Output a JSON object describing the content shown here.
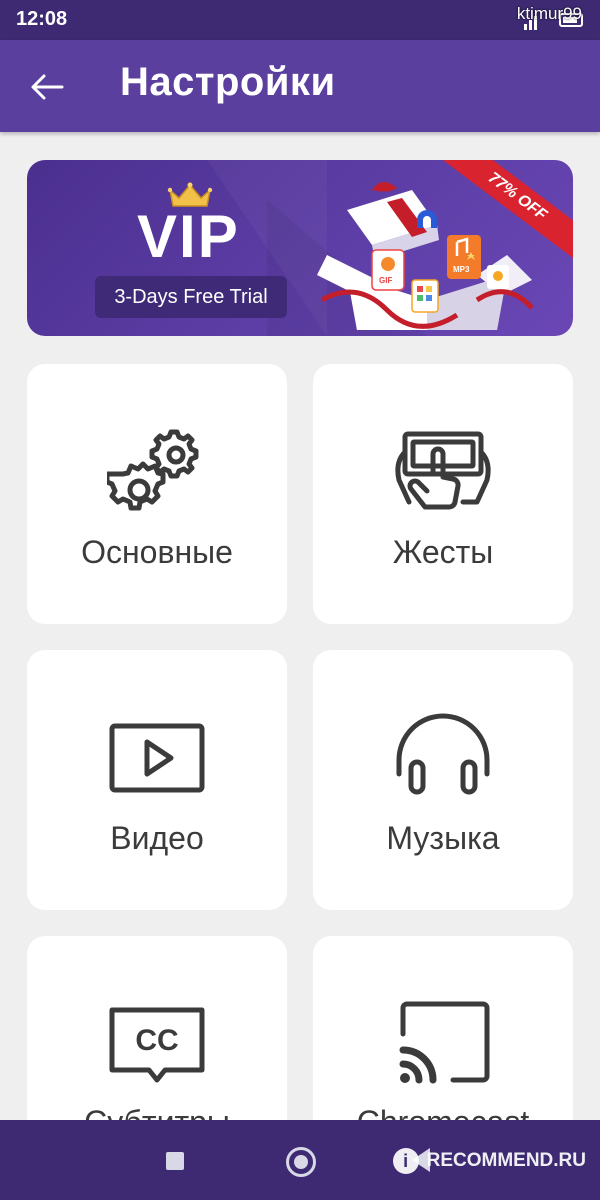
{
  "status_bar": {
    "time": "12:08",
    "watermark_user": "ktimur99"
  },
  "app_bar": {
    "title": "Настройки"
  },
  "vip_banner": {
    "title": "VIP",
    "trial_label": "3-Days Free Trial",
    "discount_label": "77% OFF",
    "gift_labels": [
      "GIF",
      "MP3"
    ]
  },
  "tiles": [
    {
      "label": "Основные",
      "icon": "gears-icon"
    },
    {
      "label": "Жесты",
      "icon": "touch-gesture-icon"
    },
    {
      "label": "Видео",
      "icon": "video-play-icon"
    },
    {
      "label": "Музыка",
      "icon": "headphones-icon"
    },
    {
      "label": "Субтитры",
      "icon": "closed-captions-icon"
    },
    {
      "label": "Chromecast",
      "icon": "cast-icon"
    }
  ],
  "nav_bar": {
    "watermark": "RECOMMEND.RU"
  },
  "colors": {
    "status_bar": "#3d2a72",
    "app_bar": "#5b3f9e",
    "background": "#efefef",
    "tile": "#ffffff",
    "icon": "#3b3b3b",
    "ribbon": "#d9232f"
  }
}
